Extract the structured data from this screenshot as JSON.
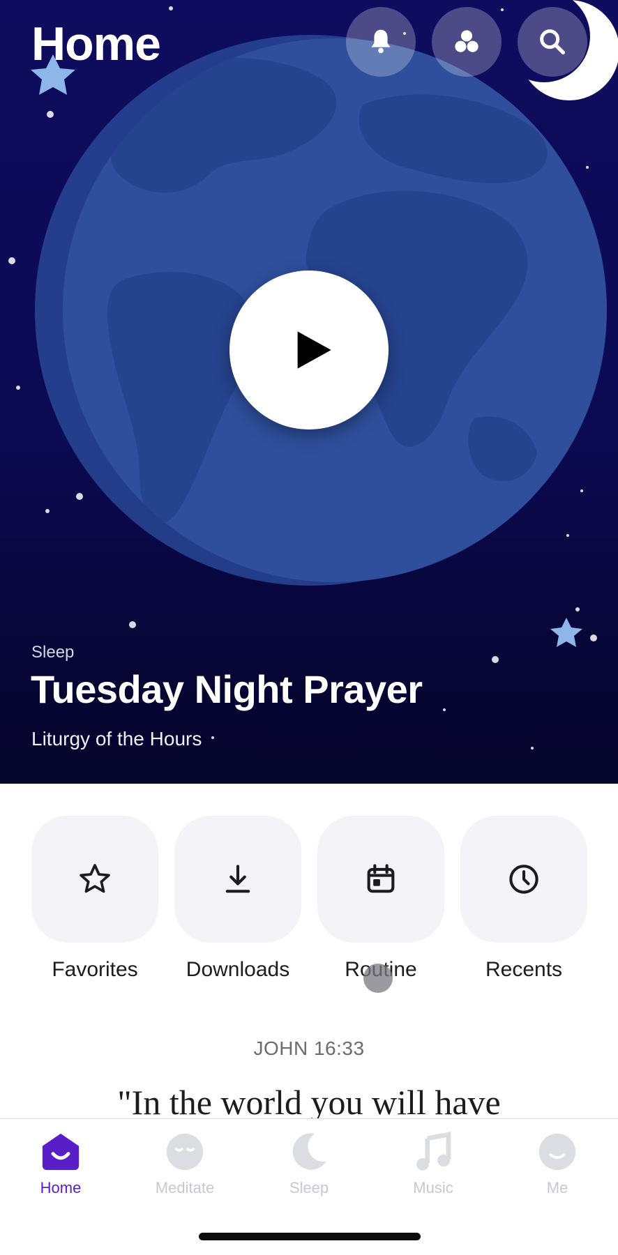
{
  "header": {
    "title": "Home"
  },
  "top_buttons": [
    {
      "icon": "bell-icon"
    },
    {
      "icon": "circles-icon"
    },
    {
      "icon": "search-icon"
    }
  ],
  "hero": {
    "category": "Sleep",
    "title": "Tuesday Night Prayer",
    "subtitle": "Liturgy of the Hours"
  },
  "quick_actions": [
    {
      "label": "Favorites",
      "icon": "star-icon"
    },
    {
      "label": "Downloads",
      "icon": "download-icon"
    },
    {
      "label": "Routine",
      "icon": "calendar-icon"
    },
    {
      "label": "Recents",
      "icon": "clock-icon"
    }
  ],
  "verse": {
    "reference": "JOHN 16:33",
    "text": "\"In the world you will have"
  },
  "tabs": [
    {
      "label": "Home",
      "icon": "home-icon",
      "active": true
    },
    {
      "label": "Meditate",
      "icon": "meditate-icon",
      "active": false
    },
    {
      "label": "Sleep",
      "icon": "moon-icon",
      "active": false
    },
    {
      "label": "Music",
      "icon": "music-note-icon",
      "active": false
    },
    {
      "label": "Me",
      "icon": "profile-icon",
      "active": false
    }
  ],
  "colors": {
    "accent": "#5a1ec8",
    "hero_background": "#0e0c5e",
    "tile_background": "#f4f3f8",
    "inactive_tab": "#c8c8d0"
  }
}
